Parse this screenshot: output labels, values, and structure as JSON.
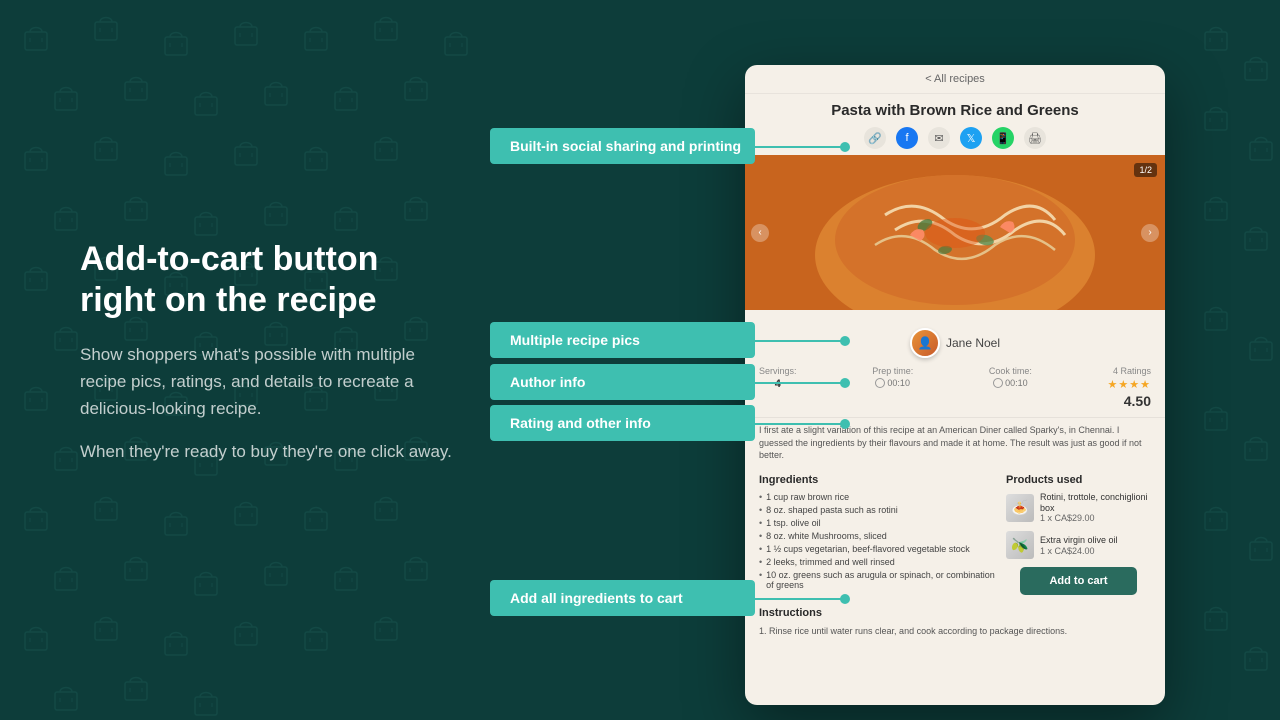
{
  "page": {
    "background_color": "#0d3d3a"
  },
  "left_panel": {
    "heading": "Add-to-cart button right on the recipe",
    "paragraph1": "Show shoppers what's possible with multiple recipe pics, ratings, and details to recreate a delicious-looking recipe.",
    "paragraph2": "When they're ready to buy they're one click away."
  },
  "callouts": {
    "social": "Built-in social sharing and printing",
    "pics": "Multiple recipe pics",
    "author": "Author info",
    "rating": "Rating and other info",
    "cart": "Add all ingredients to cart"
  },
  "recipe": {
    "back_label": "< All recipes",
    "title": "Pasta with Brown Rice and Greens",
    "image_counter": "1/2",
    "author_name": "Jane Noel",
    "servings_label": "Servings:",
    "servings_value": "4",
    "prep_label": "Prep time:",
    "prep_value": "00:10",
    "cook_label": "Cook time:",
    "cook_value": "00:10",
    "rating_count": "4 Ratings",
    "rating_stars": "★★★★",
    "rating_value": "4.50",
    "description": "I first ate a slight variation of this recipe at an American Diner called Sparky's, in Chennai. I guessed the ingredients by their flavours and made it at home. The result was just as good if not better.",
    "ingredients_title": "Ingredients",
    "products_title": "Products used",
    "ingredients": [
      "1 cup raw brown rice",
      "8 oz. shaped pasta such as rotini",
      "1 tsp. olive oil",
      "8 oz. white Mushrooms, sliced",
      "1 ½ cups vegetarian, beef-flavored vegetable stock",
      "2 leeks, trimmed and well rinsed",
      "10 oz. greens such as arugula or spinach, or combination of greens"
    ],
    "products": [
      {
        "name": "Rotini, trottole, conchiglioni box",
        "quantity": "1 x CA$29.00",
        "emoji": "🍝"
      },
      {
        "name": "Extra virgin olive oil",
        "quantity": "1 x CA$24.00",
        "emoji": "🫒"
      }
    ],
    "add_to_cart_label": "Add to cart",
    "instructions_title": "Instructions",
    "instruction1": "1. Rinse rice until water runs clear, and cook according to package directions."
  }
}
